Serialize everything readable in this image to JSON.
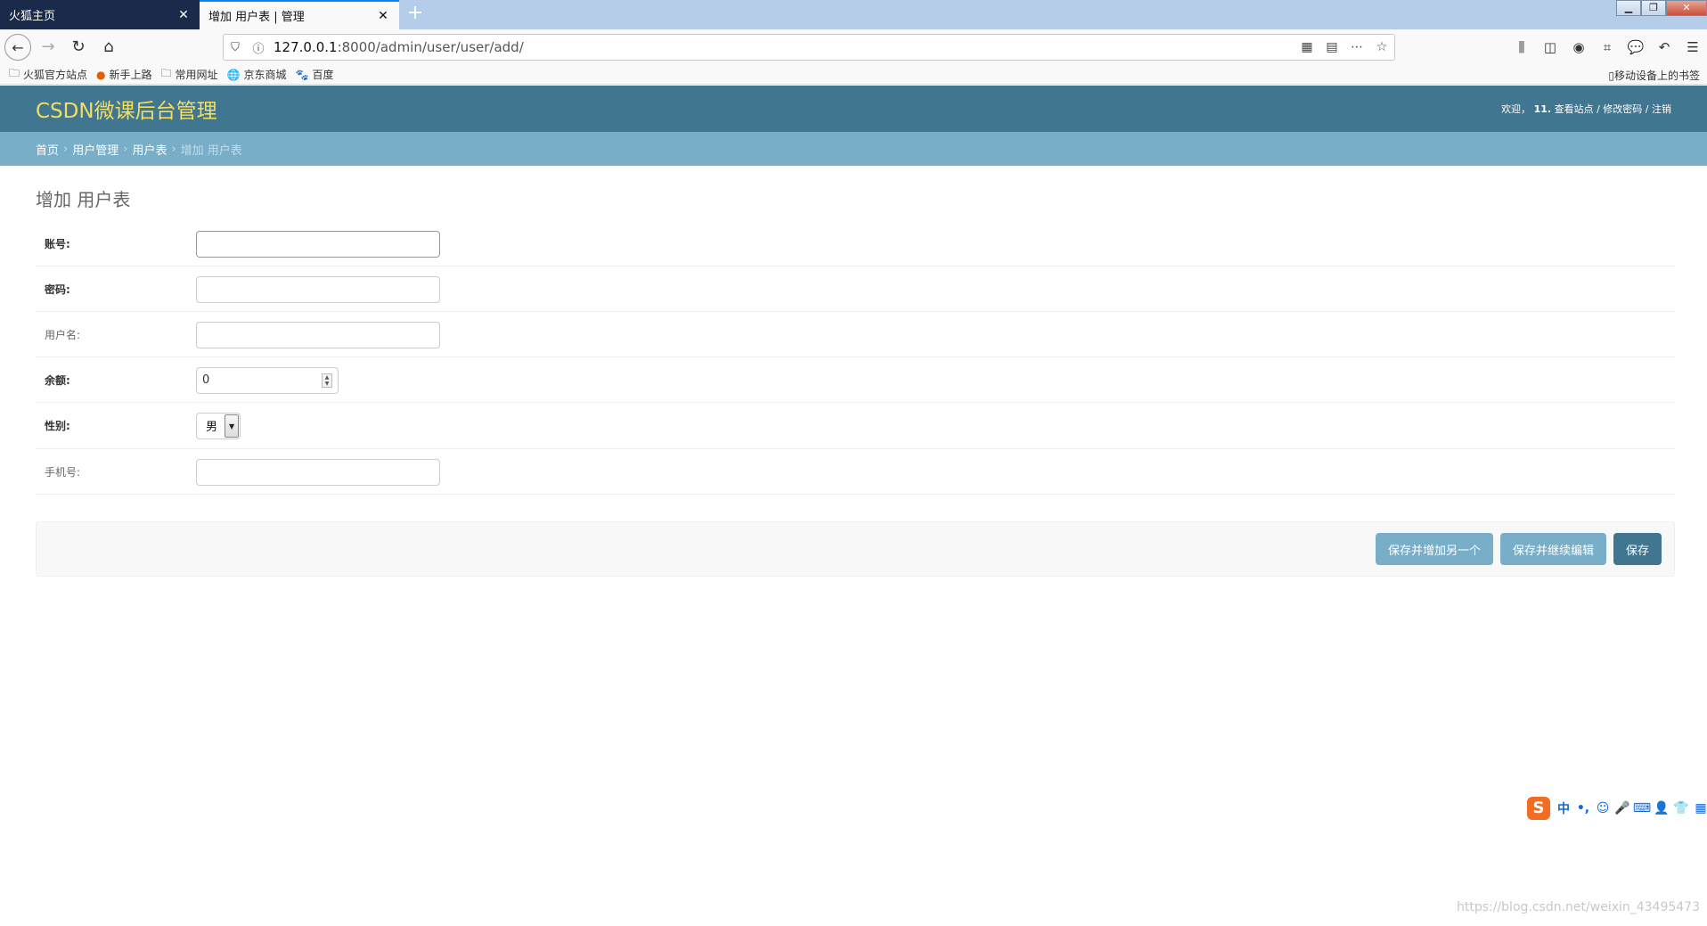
{
  "browser": {
    "tabs": [
      {
        "title": "火狐主页",
        "close": "✕"
      },
      {
        "title": "增加 用户表 | 管理",
        "close": "✕"
      }
    ],
    "new_tab": "+",
    "url": {
      "host": "127.0.0.1",
      "rest": ":8000/admin/user/user/add/"
    },
    "bookmarks": [
      {
        "icon": "folder-icon",
        "label": "火狐官方站点"
      },
      {
        "icon": "firefox-icon",
        "label": "新手上路"
      },
      {
        "icon": "folder-icon",
        "label": "常用网址"
      },
      {
        "icon": "globe-icon",
        "label": "京东商城"
      },
      {
        "icon": "paw-icon",
        "label": "百度"
      }
    ],
    "mobile_bookmarks": "移动设备上的书签"
  },
  "admin": {
    "branding": "CSDN微课后台管理",
    "user_tools": {
      "welcome": "欢迎，",
      "user": "11.",
      "view_site": "查看站点",
      "sep": "/",
      "change_password": "修改密码",
      "logout": "注销"
    },
    "breadcrumbs": [
      {
        "label": "首页"
      },
      {
        "label": "用户管理"
      },
      {
        "label": "用户表"
      },
      {
        "label": "增加 用户表"
      }
    ],
    "breadcrumb_sep": "›",
    "page_title": "增加 用户表",
    "fields": [
      {
        "label": "账号:",
        "required": true,
        "type": "text",
        "value": ""
      },
      {
        "label": "密码:",
        "required": true,
        "type": "text",
        "value": ""
      },
      {
        "label": "用户名:",
        "required": false,
        "type": "text",
        "value": ""
      },
      {
        "label": "余额:",
        "required": true,
        "type": "number",
        "value": "0"
      },
      {
        "label": "性别:",
        "required": true,
        "type": "select",
        "value": "男"
      },
      {
        "label": "手机号:",
        "required": false,
        "type": "text",
        "value": ""
      }
    ],
    "buttons": {
      "save_add_another": "保存并增加另一个",
      "save_continue": "保存并继续编辑",
      "save": "保存"
    }
  },
  "ime": {
    "logo": "S",
    "items": [
      "中",
      "•,",
      "☺",
      "🎤",
      "⌨",
      "👤",
      "👕",
      "▦"
    ]
  },
  "watermark": "https://blog.csdn.net/weixin_43495473",
  "colors": {
    "header": "#417690",
    "breadcrumbs": "#79aec8",
    "branding": "#f5dd5d",
    "button": "#79aec8",
    "button_default": "#417690"
  }
}
